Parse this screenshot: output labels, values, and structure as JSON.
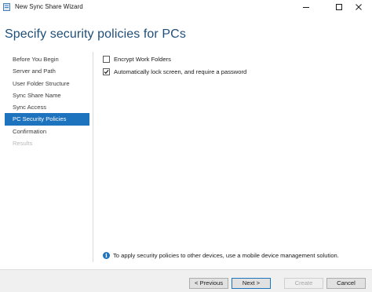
{
  "window": {
    "title": "New Sync Share Wizard",
    "controls": [
      "minimize-icon",
      "maximize-icon",
      "close-icon"
    ]
  },
  "page": {
    "heading": "Specify security policies for PCs"
  },
  "nav": {
    "items": [
      {
        "label": "Before You Begin",
        "state": "normal"
      },
      {
        "label": "Server and Path",
        "state": "normal"
      },
      {
        "label": "User Folder Structure",
        "state": "normal"
      },
      {
        "label": "Sync Share Name",
        "state": "normal"
      },
      {
        "label": "Sync Access",
        "state": "normal"
      },
      {
        "label": "PC Security Policies",
        "state": "selected"
      },
      {
        "label": "Confirmation",
        "state": "normal"
      },
      {
        "label": "Results",
        "state": "disabled"
      }
    ]
  },
  "options": {
    "encrypt": {
      "label": "Encrypt Work Folders",
      "checked": false
    },
    "autolock": {
      "label": "Automatically lock screen, and require a password",
      "checked": true
    }
  },
  "info": {
    "icon": "info-icon",
    "text": "To apply security policies to other devices, use a mobile device management solution."
  },
  "buttons": {
    "previous": "< Previous",
    "next": "Next >",
    "create": "Create",
    "cancel": "Cancel"
  },
  "colors": {
    "accent": "#1e73be",
    "heading": "#1f4e79"
  }
}
